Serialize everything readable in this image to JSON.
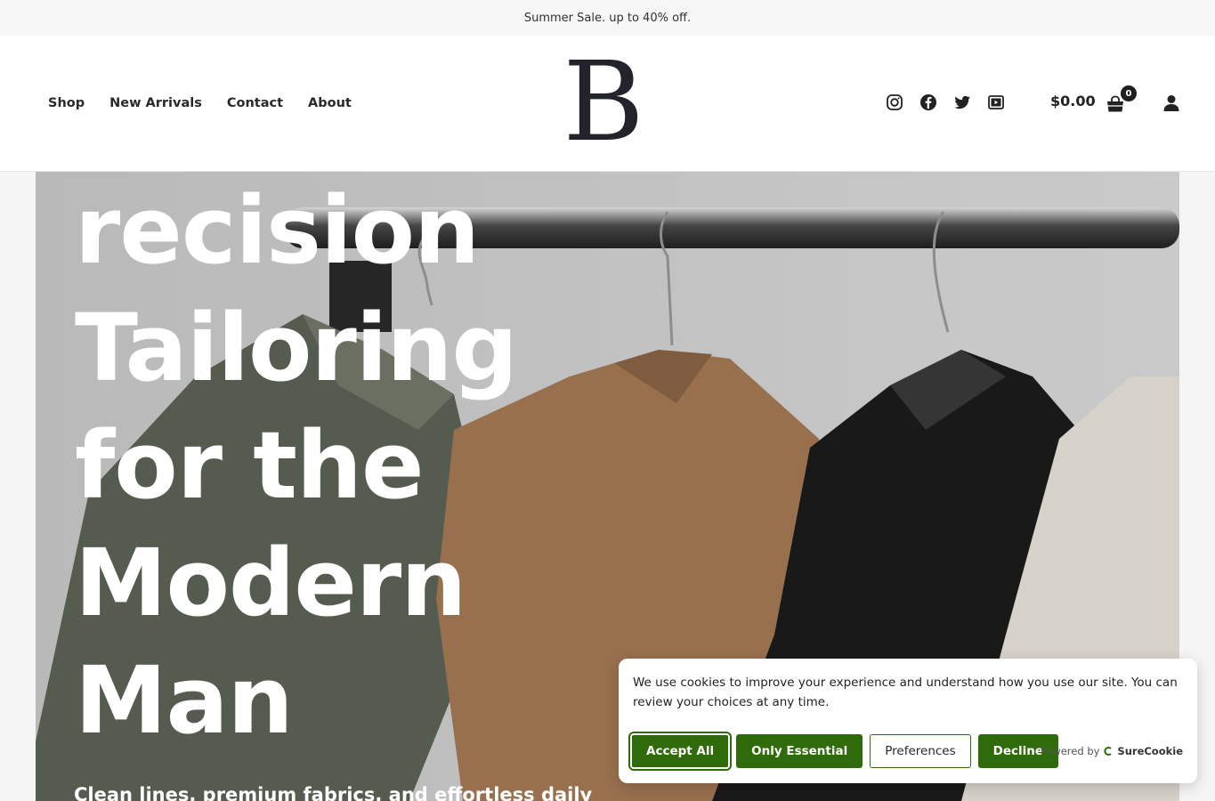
{
  "announcement": "Summer Sale. up to 40% off.",
  "nav": [
    "Shop",
    "New Arrivals",
    "Contact",
    "About"
  ],
  "logo_letter": "B",
  "social_icons": [
    "instagram-icon",
    "facebook-icon",
    "twitter-icon",
    "youtube-icon"
  ],
  "cart": {
    "total": "$0.00",
    "count": "0"
  },
  "hero": {
    "title_lines": [
      "recision",
      "Tailoring",
      "for the",
      "Modern",
      "Man"
    ],
    "subtitle": "Clean lines, premium fabrics, and effortless daily"
  },
  "cookie": {
    "message": "We use cookies to improve your experience and understand how you use our site. You can review your choices at any time.",
    "buttons": {
      "accept": "Accept All",
      "essential": "Only Essential",
      "preferences": "Preferences",
      "decline": "Decline"
    },
    "powered_by": "Powered by",
    "brand": "SureCookie"
  },
  "colors": {
    "accent_green": "#2f6b0a",
    "logo": "#23232b"
  }
}
